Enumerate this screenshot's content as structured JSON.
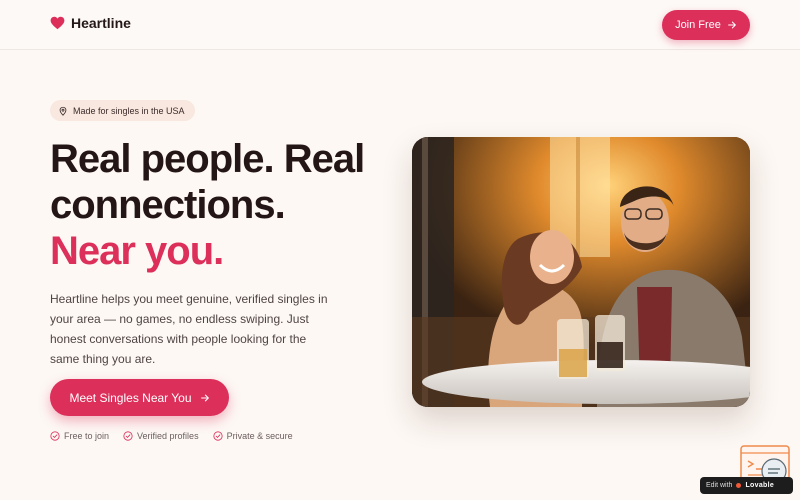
{
  "header": {
    "brand": "Heartline",
    "join_label": "Join Free"
  },
  "hero": {
    "location_pill": "Made for singles in the USA",
    "headline_line1": "Real people. Real connections.",
    "headline_accent": "Near you.",
    "description": "Heartline helps you meet genuine, verified singles in your area — no games, no endless swiping. Just honest conversations with people looking for the same thing you are.",
    "cta_label": "Meet Singles Near You",
    "features": [
      "Free to join",
      "Verified profiles",
      "Private & secure"
    ]
  },
  "badge": {
    "prefix": "Edit with",
    "brand": "Lovable"
  },
  "icons": {
    "logo": "heart-icon",
    "pill": "map-pin-icon",
    "cta": "arrow-right-icon",
    "feature": "check-circle-icon"
  },
  "colors": {
    "accent": "#dc2f5a",
    "background": "#fdf8f4",
    "heading": "#241616"
  }
}
